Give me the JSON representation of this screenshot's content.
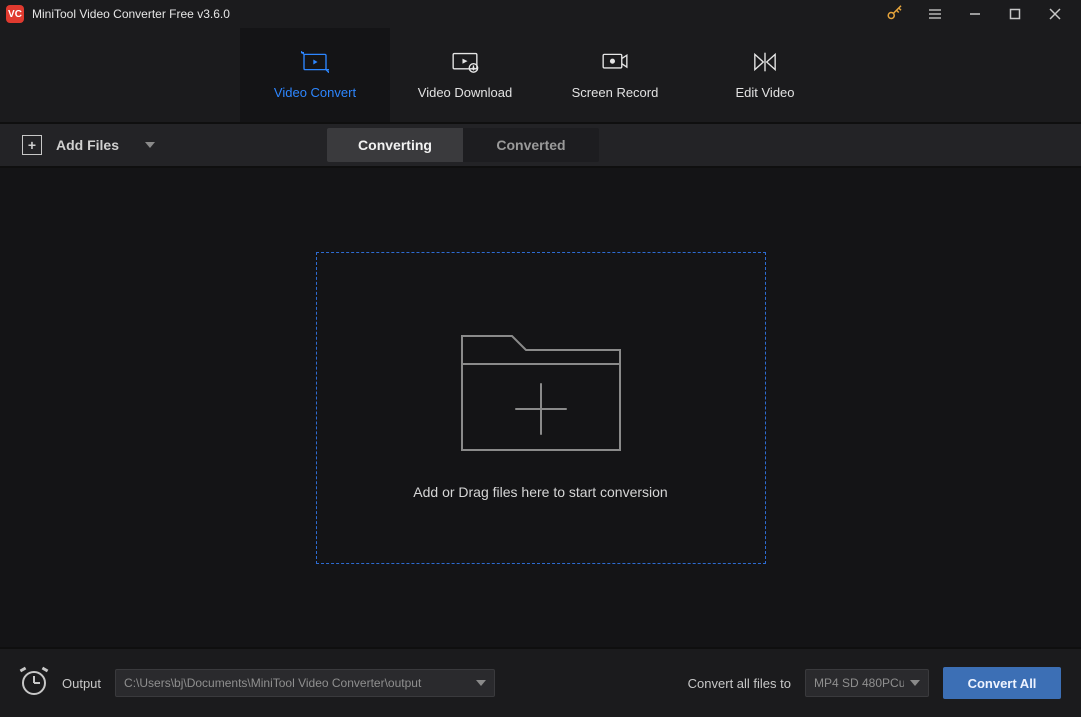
{
  "titlebar": {
    "app_title": "MiniTool Video Converter Free v3.6.0",
    "logo_text": "VC"
  },
  "nav": {
    "tabs": [
      {
        "label": "Video Convert",
        "active": true
      },
      {
        "label": "Video Download",
        "active": false
      },
      {
        "label": "Screen Record",
        "active": false
      },
      {
        "label": "Edit Video",
        "active": false
      }
    ]
  },
  "toolbar": {
    "add_files_label": "Add Files",
    "seg": {
      "converting": "Converting",
      "converted": "Converted",
      "active": "converting"
    }
  },
  "dropzone": {
    "hint": "Add or Drag files here to start conversion"
  },
  "footer": {
    "output_label": "Output",
    "output_path": "C:\\Users\\bj\\Documents\\MiniTool Video Converter\\output",
    "convert_all_to_label": "Convert all files to",
    "format_selected": "MP4 SD 480PCu",
    "convert_all_button": "Convert All"
  }
}
